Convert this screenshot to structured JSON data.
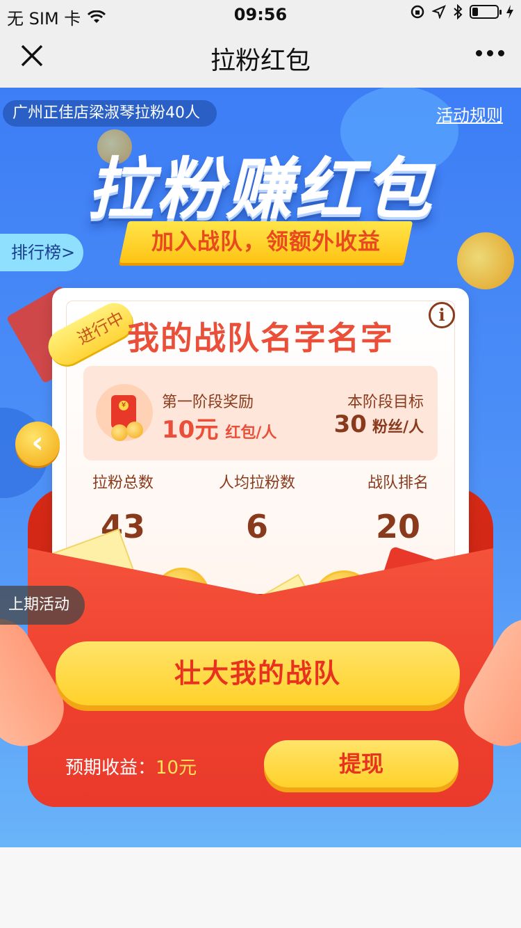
{
  "status_bar": {
    "carrier": "无 SIM 卡",
    "time": "09:56"
  },
  "nav": {
    "title": "拉粉红包"
  },
  "header": {
    "ticker": "广州正佳店梁淑琴拉粉40人",
    "rules_link": "活动规则",
    "hero_title": "拉粉赚红包",
    "hero_subtitle": "加入战队，领额外收益",
    "ranking_button": "排行榜>"
  },
  "card": {
    "status": "进行中",
    "team_name": "我的战队名字名字",
    "reward": {
      "stage_label": "第一阶段奖励",
      "stage_amount": "10元",
      "stage_unit": "红包/人",
      "target_label": "本阶段目标",
      "target_value": "30",
      "target_unit": "粉丝/人"
    },
    "stats": [
      {
        "label": "拉粉总数",
        "value": "43"
      },
      {
        "label": "人均拉粉数",
        "value": "6"
      },
      {
        "label": "战队排名",
        "value": "20"
      }
    ]
  },
  "side": {
    "last_activity": "上期活动"
  },
  "actions": {
    "grow_team": "壮大我的战队",
    "expected_label": "预期收益：",
    "expected_value": "10元",
    "withdraw": "提现"
  },
  "colors": {
    "brand_blue": "#3d7df6",
    "envelope_red": "#ee3f2e",
    "gold": "#ffd12a",
    "accent_red": "#ea4f3a",
    "brown_text": "#8a3a1c"
  }
}
